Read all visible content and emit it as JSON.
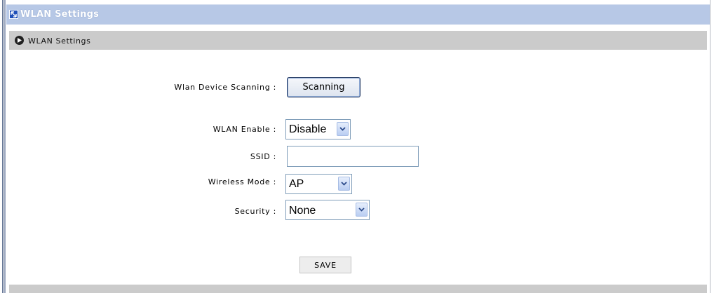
{
  "header": {
    "title": "WLAN Settings"
  },
  "section": {
    "title": "WLAN Settings"
  },
  "form": {
    "scanning": {
      "label": "Wlan Device Scanning :",
      "button_label": "Scanning"
    },
    "wlan_enable": {
      "label": "WLAN Enable :",
      "value": "Disable"
    },
    "ssid": {
      "label": "SSID :",
      "value": ""
    },
    "wireless_mode": {
      "label": "Wireless Mode :",
      "value": "AP"
    },
    "security": {
      "label": "Security :",
      "value": "None"
    }
  },
  "actions": {
    "save_label": "SAVE"
  },
  "colors": {
    "title_bar": "#b7c8e6",
    "section_bar": "#cbcbcb",
    "title_icon": "#1e4fb8"
  },
  "icons": {
    "title": "arrow-diagonal-icon",
    "section": "circle-play-icon",
    "dropdown": "chevron-down-icon"
  }
}
